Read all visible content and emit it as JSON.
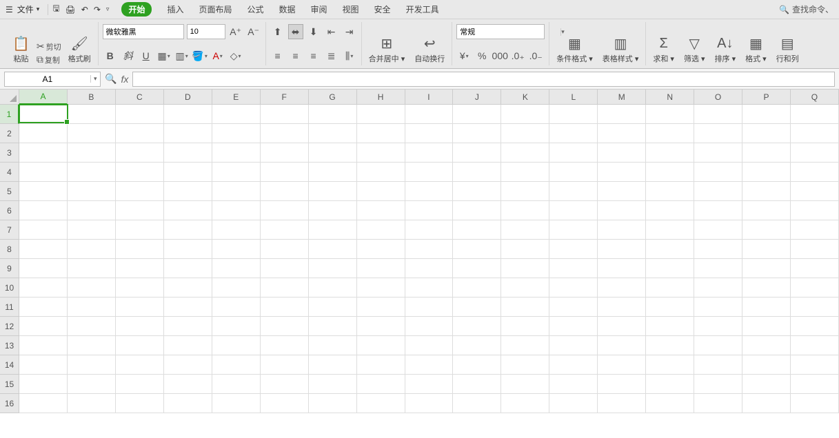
{
  "menubar": {
    "file_label": "文件",
    "tabs": [
      "开始",
      "插入",
      "页面布局",
      "公式",
      "数据",
      "审阅",
      "视图",
      "安全",
      "开发工具"
    ],
    "active_tab": "开始",
    "search_label": "查找命令、"
  },
  "ribbon": {
    "paste": "粘贴",
    "cut": "剪切",
    "copy": "复制",
    "format_painter": "格式刷",
    "font_name": "微软雅黑",
    "font_size": "10",
    "bold_char": "B",
    "italic_char": "斜",
    "underline_char": "U",
    "merge_center": "合并居中",
    "auto_wrap": "自动换行",
    "number_format": "常规",
    "cond_format": "条件格式",
    "table_style": "表格样式",
    "sum": "求和",
    "filter": "筛选",
    "sort": "排序",
    "format": "格式",
    "row_col": "行和列"
  },
  "formula_bar": {
    "cell_ref": "A1",
    "fx_label": "fx",
    "formula_value": ""
  },
  "grid": {
    "columns": [
      "A",
      "B",
      "C",
      "D",
      "E",
      "F",
      "G",
      "H",
      "I",
      "J",
      "K",
      "L",
      "M",
      "N",
      "O",
      "P",
      "Q"
    ],
    "rows": [
      1,
      2,
      3,
      4,
      5,
      6,
      7,
      8,
      9,
      10,
      11,
      12,
      13,
      14,
      15,
      16
    ],
    "selected_col": "A",
    "selected_row": 1
  }
}
